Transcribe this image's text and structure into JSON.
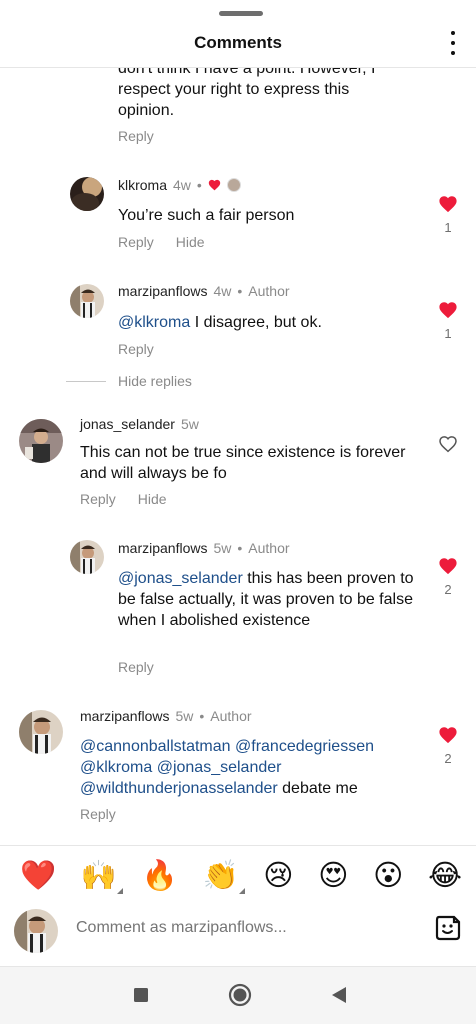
{
  "header": {
    "title": "Comments"
  },
  "comments": [
    {
      "body_partial": "don't think I have a point. However, I respect your right to express this opinion.",
      "reply_label": "Reply"
    },
    {
      "username": "klkroma",
      "time": "4w",
      "body": "You’re such a fair person",
      "reply_label": "Reply",
      "hide_label": "Hide",
      "like_count": "1",
      "liked": true
    },
    {
      "username": "marzipanflows",
      "time": "4w",
      "author_tag": "Author",
      "mention": "@klkroma",
      "body": " I disagree, but ok.",
      "reply_label": "Reply",
      "like_count": "1",
      "liked": true
    },
    {
      "username": "jonas_selander",
      "time": "5w",
      "body": "This can not be true since existence is forever and will always be fo",
      "reply_label": "Reply",
      "hide_label": "Hide",
      "liked": false
    },
    {
      "username": "marzipanflows",
      "time": "5w",
      "author_tag": "Author",
      "mention": "@jonas_selander",
      "body": " this has been proven to be false actually, it was proven to be false when I abolished existence",
      "reply_label": "Reply",
      "like_count": "2",
      "liked": true
    },
    {
      "username": "marzipanflows",
      "time": "5w",
      "author_tag": "Author",
      "mentions": [
        "@cannonballstatman",
        "@francedegriessen",
        "@klkroma",
        "@jonas_selander",
        "@wildthunderjonasselander"
      ],
      "body": " debate me",
      "reply_label": "Reply",
      "like_count": "2",
      "liked": true
    }
  ],
  "hide_replies_label": "Hide replies",
  "dot": "•",
  "emoji_bar": [
    "❤️",
    "🙌",
    "🔥",
    "👏",
    "😢",
    "😍",
    "😮",
    "😂"
  ],
  "composer": {
    "placeholder": "Comment as marzipanflows..."
  },
  "colors": {
    "heart": "#ed1c3b",
    "mention": "#1e4f8a",
    "muted": "#8a8a8a"
  },
  "icons": [
    "more-options-icon",
    "heart-icon",
    "heart-outline-icon",
    "sticker-icon",
    "nav-recents-icon",
    "nav-home-icon",
    "nav-back-icon"
  ]
}
